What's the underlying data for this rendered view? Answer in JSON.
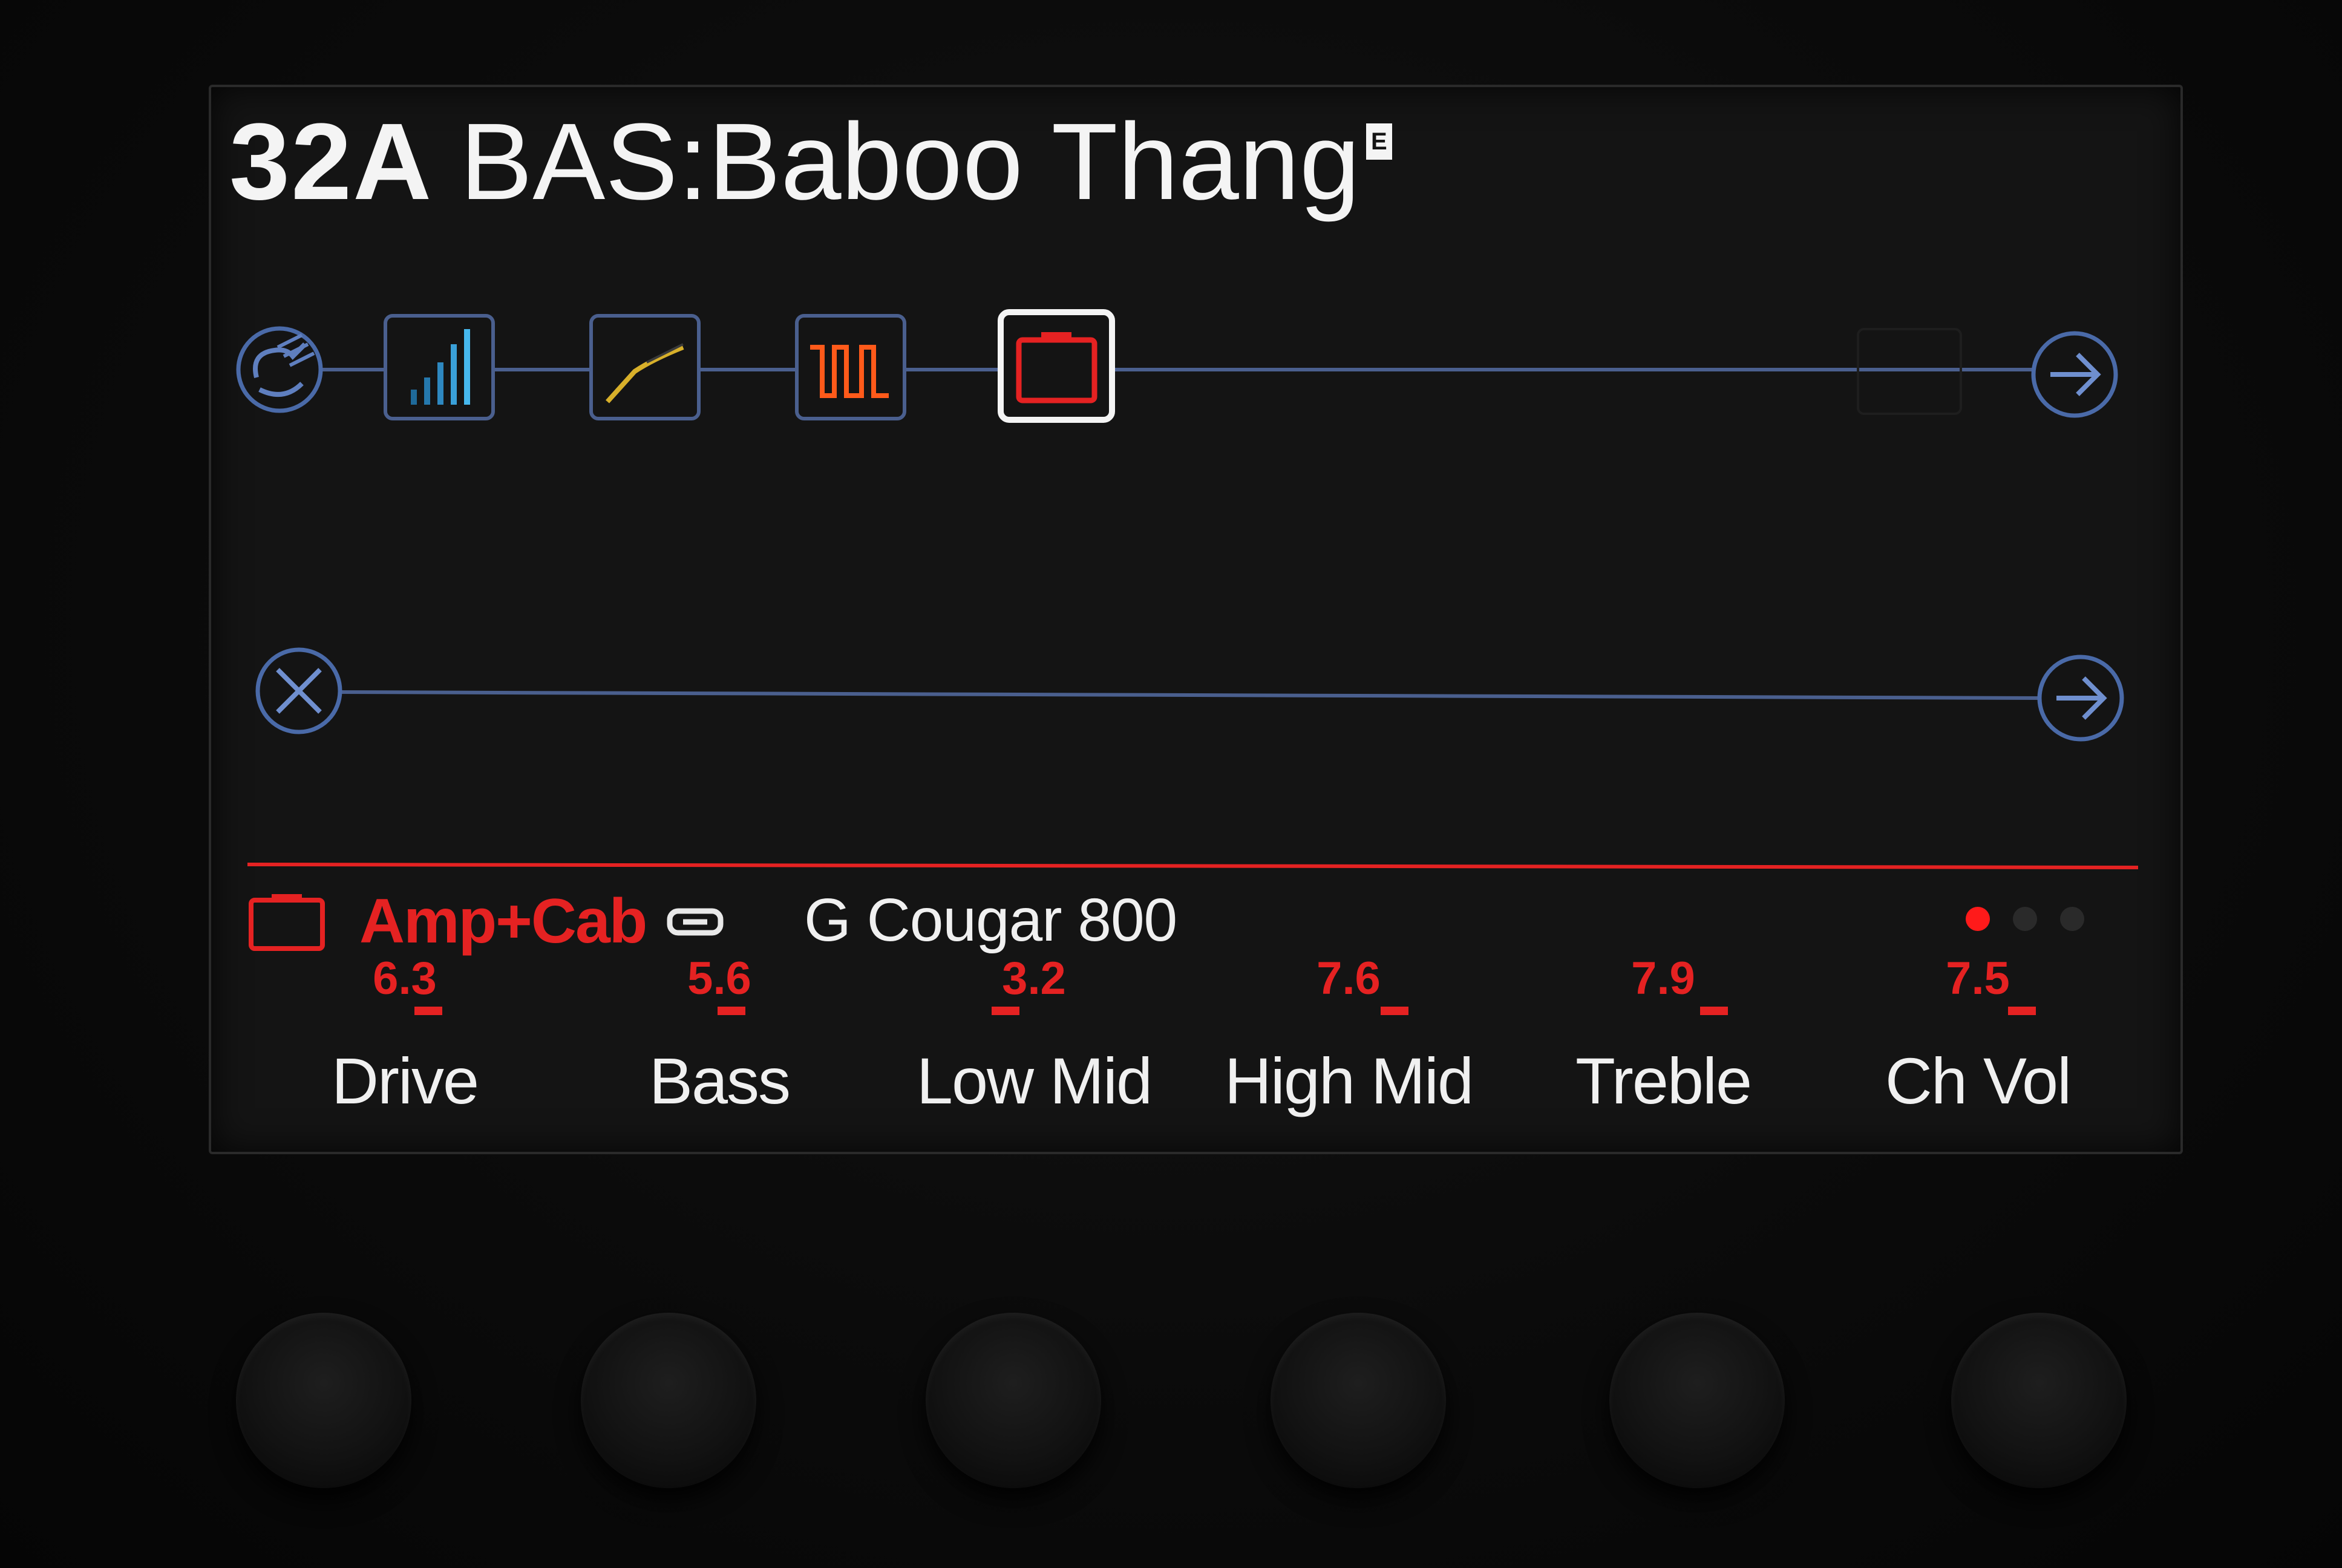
{
  "preset": {
    "number": "32A",
    "name": "BAS:Baboo Thang",
    "edited_flag": "E"
  },
  "signal_path": {
    "path1_blocks": [
      {
        "name": "input",
        "icon": "guitar-input-icon"
      },
      {
        "name": "block-1",
        "icon": "bar-graph-eq-icon"
      },
      {
        "name": "block-2",
        "icon": "ramp-line-icon"
      },
      {
        "name": "block-3",
        "icon": "square-wave-icon"
      },
      {
        "name": "block-4",
        "icon": "amp-icon",
        "selected": true
      },
      {
        "name": "output",
        "icon": "arrow-out-icon"
      }
    ],
    "path2_blocks": [
      {
        "name": "input",
        "icon": "x-circle-icon"
      },
      {
        "name": "output",
        "icon": "arrow-out-icon"
      }
    ]
  },
  "model": {
    "category": "Amp+Cab",
    "category_icon": "amp-icon",
    "link_icon": "link-icon",
    "name": "G Cougar 800",
    "page_count": 3,
    "active_page": 1
  },
  "params": [
    {
      "label": "Drive",
      "value": "6.3",
      "level": 0.63
    },
    {
      "label": "Bass",
      "value": "5.6",
      "level": 0.56
    },
    {
      "label": "Low Mid",
      "value": "3.2",
      "level": 0.32
    },
    {
      "label": "High Mid",
      "value": "7.6",
      "level": 0.76
    },
    {
      "label": "Treble",
      "value": "7.9",
      "level": 0.79
    },
    {
      "label": "Ch Vol",
      "value": "7.5",
      "level": 0.75
    }
  ],
  "colors": {
    "accent": "#e52222",
    "path_line": "#4a5f8e",
    "text": "#f0f0f0",
    "eq_blue": "#3aa0d8",
    "ramp_yellow": "#d8b02a",
    "wave_orange": "#ff5a1a",
    "amp_red": "#e52222"
  }
}
